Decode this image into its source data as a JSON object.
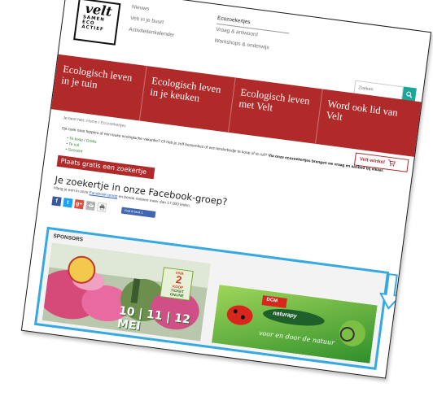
{
  "logo": {
    "wordmark": "velt",
    "lines": [
      "SAMEN",
      "ECO",
      "ACTIEF"
    ]
  },
  "topnav": {
    "col1": [
      "Nieuws",
      "Velt in je buurt",
      "Activiteitenkalender"
    ],
    "col2": [
      "Ecozoekertjes",
      "Vraag & antwoord",
      "Workshops & onderwijs"
    ]
  },
  "search": {
    "placeholder": "Zoeken",
    "icon": "search-icon"
  },
  "mainnav": [
    "Ecologisch leven in je tuin",
    "Ecologisch leven in je keuken",
    "Ecologisch leven met Velt",
    "Word ook lid van Velt"
  ],
  "shop": {
    "label": "Velt-winkel",
    "icon": "cart-icon"
  },
  "breadcrumb": {
    "prefix": "Je bent hier:",
    "home": "Home",
    "sep": "/",
    "current": "Ecozoekertjes"
  },
  "intro": {
    "text": "Op zoek naar hippers of een leuke ecologische vakantie? Of heb je zelf bessenkes of een kinderbedje te koop of te ruil?",
    "bold": "Via onze ecozoekertjes brengen we vraag en aanbod bij elkaar."
  },
  "links": [
    "Te koop / Gratis",
    "Te ruil",
    "Gezocht"
  ],
  "cta": "Plaats gratis een zoekertje",
  "facebook": {
    "heading": "Je zoekertje in onze Facebook-groep?",
    "text_before": "Hang je een in onze",
    "link": "Facebook-groep",
    "text_after": "en bereik meteen meer dan 17.000 leden.",
    "like_label": "Vind ik leuk 1"
  },
  "share_icons": [
    "facebook-icon",
    "twitter-icon",
    "google-plus-icon",
    "email-icon",
    "print-icon"
  ],
  "sponsors": {
    "label": "SPONSORS",
    "ad1": {
      "badge_lines": [
        "VIVA",
        "2",
        "KOOP",
        "TICKET ONLINE"
      ],
      "dates": [
        "10",
        "11",
        "12",
        "MEI"
      ]
    },
    "ad2": {
      "brand": "DCM",
      "product": "naturapy",
      "slogan": "voor en door de natuur"
    }
  },
  "colors": {
    "brand_red": "#b02a2a",
    "accent_teal": "#1aa79a",
    "sponsor_border": "#35a9e0",
    "fb_blue": "#3b5998"
  }
}
